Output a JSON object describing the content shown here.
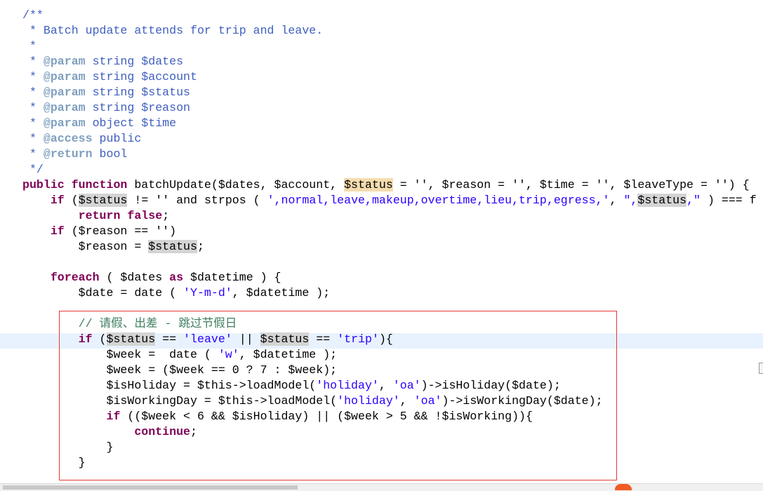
{
  "editor": {
    "lines": [
      [
        {
          "t": "/**",
          "c": "cm"
        }
      ],
      [
        {
          "t": " * Batch update attends for trip and leave.",
          "c": "cm"
        }
      ],
      [
        {
          "t": " *",
          "c": "cm"
        }
      ],
      [
        {
          "t": " * ",
          "c": "cm"
        },
        {
          "t": "@param",
          "c": "tag"
        },
        {
          "t": " string $dates",
          "c": "cm"
        }
      ],
      [
        {
          "t": " * ",
          "c": "cm"
        },
        {
          "t": "@param",
          "c": "tag"
        },
        {
          "t": " string $account",
          "c": "cm"
        }
      ],
      [
        {
          "t": " * ",
          "c": "cm"
        },
        {
          "t": "@param",
          "c": "tag"
        },
        {
          "t": " string $status",
          "c": "cm"
        }
      ],
      [
        {
          "t": " * ",
          "c": "cm"
        },
        {
          "t": "@param",
          "c": "tag"
        },
        {
          "t": " string $reason",
          "c": "cm"
        }
      ],
      [
        {
          "t": " * ",
          "c": "cm"
        },
        {
          "t": "@param",
          "c": "tag"
        },
        {
          "t": " object $time",
          "c": "cm"
        }
      ],
      [
        {
          "t": " * ",
          "c": "cm"
        },
        {
          "t": "@access",
          "c": "tag"
        },
        {
          "t": " public",
          "c": "cm"
        }
      ],
      [
        {
          "t": " * ",
          "c": "cm"
        },
        {
          "t": "@return",
          "c": "tag"
        },
        {
          "t": " bool",
          "c": "cm"
        }
      ],
      [
        {
          "t": " */",
          "c": "cm"
        }
      ],
      [
        {
          "t": "public",
          "c": "kw"
        },
        {
          "t": " "
        },
        {
          "t": "function",
          "c": "kw"
        },
        {
          "t": " batchUpdate($dates, $account, "
        },
        {
          "t": "$status",
          "c": "hl2"
        },
        {
          "t": " = '', $reason = '', $time = '', $leaveType = '') {"
        }
      ],
      [
        {
          "t": "    "
        },
        {
          "t": "if",
          "c": "kw"
        },
        {
          "t": " ("
        },
        {
          "t": "$status",
          "c": "hl"
        },
        {
          "t": " != '' and strpos ( "
        },
        {
          "t": "',normal,leave,makeup,overtime,lieu,trip,egress,'",
          "c": "str"
        },
        {
          "t": ", "
        },
        {
          "t": "\",",
          "c": "str"
        },
        {
          "t": "$status",
          "c": "hl"
        },
        {
          "t": ",\"",
          "c": "str"
        },
        {
          "t": " ) === f"
        }
      ],
      [
        {
          "t": "        "
        },
        {
          "t": "return",
          "c": "kw"
        },
        {
          "t": " "
        },
        {
          "t": "false",
          "c": "kw"
        },
        {
          "t": ";"
        }
      ],
      [
        {
          "t": "    "
        },
        {
          "t": "if",
          "c": "kw"
        },
        {
          "t": " ($reason == '')"
        }
      ],
      [
        {
          "t": "        $reason = "
        },
        {
          "t": "$status",
          "c": "hl"
        },
        {
          "t": ";"
        }
      ],
      [],
      [
        {
          "t": "    "
        },
        {
          "t": "foreach",
          "c": "kw"
        },
        {
          "t": " ( $dates "
        },
        {
          "t": "as",
          "c": "kw"
        },
        {
          "t": " $datetime ) {"
        }
      ],
      [
        {
          "t": "        $date = date ( "
        },
        {
          "t": "'Y-m-d'",
          "c": "str"
        },
        {
          "t": ", $datetime );"
        }
      ],
      [],
      [
        {
          "t": "        "
        },
        {
          "t": "// 请假、出差 - 跳过节假日",
          "c": "lc"
        }
      ],
      [
        {
          "t": "        "
        },
        {
          "t": "if",
          "c": "kw"
        },
        {
          "t": " ("
        },
        {
          "t": "$status",
          "c": "hl"
        },
        {
          "t": " == "
        },
        {
          "t": "'leave'",
          "c": "str"
        },
        {
          "t": " || "
        },
        {
          "t": "$statu",
          "c": "hl"
        },
        {
          "t": "|",
          "c": "caret"
        },
        {
          "t": "s",
          "c": "hl"
        },
        {
          "t": " == "
        },
        {
          "t": "'trip'",
          "c": "str"
        },
        {
          "t": "){"
        }
      ],
      [
        {
          "t": "            $week =  date ( "
        },
        {
          "t": "'w'",
          "c": "str"
        },
        {
          "t": ", $datetime );"
        }
      ],
      [
        {
          "t": "            $week = ($week == 0 ? 7 : $week);"
        }
      ],
      [
        {
          "t": "            $isHoliday = $this->loadModel("
        },
        {
          "t": "'holiday'",
          "c": "str"
        },
        {
          "t": ", "
        },
        {
          "t": "'oa'",
          "c": "str"
        },
        {
          "t": ")->isHoliday($date);"
        }
      ],
      [
        {
          "t": "            $isWorkingDay = $this->loadModel("
        },
        {
          "t": "'holiday'",
          "c": "str"
        },
        {
          "t": ", "
        },
        {
          "t": "'oa'",
          "c": "str"
        },
        {
          "t": ")->isWorkingDay($date);"
        }
      ],
      [
        {
          "t": "            "
        },
        {
          "t": "if",
          "c": "kw"
        },
        {
          "t": " (($week < 6 && $isHoliday) || ($week > 5 && !$isWorking)){"
        }
      ],
      [
        {
          "t": "                "
        },
        {
          "t": "continue",
          "c": "kw"
        },
        {
          "t": ";"
        }
      ],
      [
        {
          "t": "            }"
        }
      ],
      [
        {
          "t": "        }"
        }
      ]
    ]
  },
  "colors": {
    "highlight_box": "#e53935",
    "current_line": "#e8f2fe",
    "keyword": "#7f0055",
    "string": "#2a00ff"
  }
}
